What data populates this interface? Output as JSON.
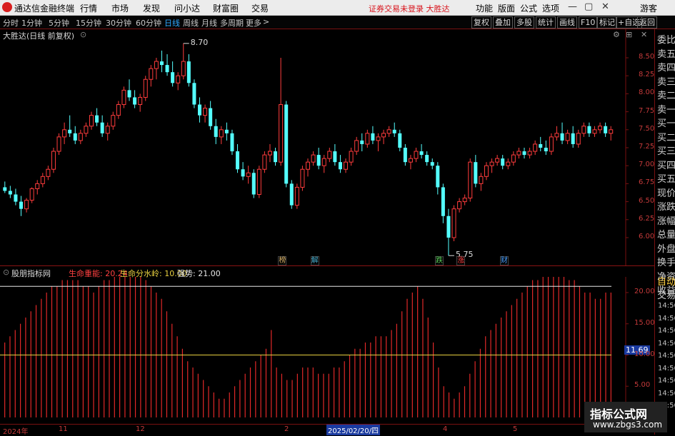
{
  "menubar": {
    "app_title": "通达信金融终端",
    "menus": [
      "行情",
      "市场",
      "发现",
      "问小达",
      "财富圈",
      "交易"
    ],
    "notice": "证券交易未登录  大胜达",
    "right_menus": [
      "功能",
      "版面",
      "公式",
      "选项"
    ],
    "user": "游客"
  },
  "periodbar": {
    "periods": [
      "分时",
      "1分钟",
      "5分钟",
      "15分钟",
      "30分钟",
      "60分钟",
      "日线",
      "周线",
      "月线",
      "多周期",
      "更多"
    ],
    "active_period": "日线",
    "tools": [
      "复权",
      "叠加",
      "多股",
      "统计",
      "画线",
      "F10",
      "标记",
      "+自选",
      "返回"
    ]
  },
  "main_chart": {
    "title": "大胜达(日线 前复权)",
    "y_ticks": [
      "8.50",
      "8.25",
      "8.00",
      "7.75",
      "7.50",
      "7.25",
      "7.00",
      "6.75",
      "6.50",
      "6.25",
      "6.00"
    ],
    "high_label": "8.70",
    "low_label": "5.75",
    "markers": [
      {
        "text": "榜",
        "color": "#d9b36a"
      },
      {
        "text": "解",
        "color": "#4ab0d0"
      },
      {
        "text": "跌",
        "color": "#5ad05a"
      },
      {
        "text": "涨",
        "color": "#ff4040"
      },
      {
        "text": "财",
        "color": "#4aa0ff"
      }
    ]
  },
  "indicator": {
    "name": "股朋指标网",
    "items": [
      {
        "label": "生命重能: 20.24",
        "color": "#ff4040"
      },
      {
        "label": "生命分水岭: 10.00",
        "color": "#e8d040"
      },
      {
        "label": "强势: 21.00",
        "color": "#e8e8e8"
      }
    ],
    "y_ticks": [
      "20.00",
      "15.00",
      "10.00",
      "5.00"
    ],
    "current_value": "11.69"
  },
  "x_axis": {
    "labels": [
      "2024年",
      "11",
      "12",
      "2",
      "2025/02/20/四",
      "4",
      "5"
    ]
  },
  "right_panel": {
    "labels": [
      "委比",
      "卖五",
      "卖四",
      "卖三",
      "卖二",
      "卖一",
      "买一",
      "买二",
      "买三",
      "买四",
      "买五",
      "现价",
      "涨跌",
      "涨幅",
      "总量",
      "外盘",
      "换手",
      "净资",
      "收益",
      "自动",
      "交易"
    ],
    "times": [
      "14:56",
      "14:56",
      "14:56",
      "14:56",
      "14:56",
      "14:56",
      "14:56",
      "14:56",
      "14:56"
    ]
  },
  "watermark": {
    "title": "指标公式网",
    "url": "www.zbgs3.com"
  },
  "chart_data": [
    {
      "type": "candlestick",
      "title": "大胜达(日线 前复权)",
      "ylim": [
        5.75,
        8.75
      ],
      "ohlc": [
        [
          6.7,
          6.78,
          6.62,
          6.65
        ],
        [
          6.65,
          6.72,
          6.55,
          6.6
        ],
        [
          6.6,
          6.68,
          6.45,
          6.5
        ],
        [
          6.5,
          6.58,
          6.3,
          6.4
        ],
        [
          6.4,
          6.55,
          6.35,
          6.52
        ],
        [
          6.52,
          6.7,
          6.48,
          6.68
        ],
        [
          6.68,
          6.8,
          6.6,
          6.75
        ],
        [
          6.75,
          6.9,
          6.7,
          6.85
        ],
        [
          6.85,
          7.0,
          6.8,
          6.95
        ],
        [
          6.95,
          7.25,
          6.9,
          7.2
        ],
        [
          7.2,
          7.45,
          7.15,
          7.4
        ],
        [
          7.4,
          7.6,
          7.3,
          7.5
        ],
        [
          7.5,
          7.7,
          7.4,
          7.45
        ],
        [
          7.45,
          7.55,
          7.3,
          7.35
        ],
        [
          7.35,
          7.5,
          7.3,
          7.45
        ],
        [
          7.45,
          7.6,
          7.4,
          7.55
        ],
        [
          7.55,
          7.75,
          7.5,
          7.7
        ],
        [
          7.7,
          7.8,
          7.55,
          7.6
        ],
        [
          7.6,
          7.7,
          7.4,
          7.45
        ],
        [
          7.45,
          7.6,
          7.35,
          7.55
        ],
        [
          7.55,
          7.75,
          7.5,
          7.7
        ],
        [
          7.7,
          7.9,
          7.65,
          7.85
        ],
        [
          7.85,
          8.1,
          7.8,
          8.05
        ],
        [
          8.05,
          8.2,
          7.9,
          7.95
        ],
        [
          7.95,
          8.05,
          7.8,
          7.85
        ],
        [
          7.85,
          8.0,
          7.75,
          7.95
        ],
        [
          7.95,
          8.25,
          7.9,
          8.2
        ],
        [
          8.2,
          8.4,
          8.1,
          8.35
        ],
        [
          8.35,
          8.5,
          8.2,
          8.45
        ],
        [
          8.45,
          8.6,
          8.3,
          8.4
        ],
        [
          8.4,
          8.55,
          8.25,
          8.3
        ],
        [
          8.3,
          8.45,
          8.1,
          8.15
        ],
        [
          8.15,
          8.3,
          8.05,
          8.25
        ],
        [
          8.25,
          8.7,
          8.2,
          8.45
        ],
        [
          8.45,
          8.55,
          8.1,
          8.15
        ],
        [
          8.15,
          8.2,
          7.8,
          7.85
        ],
        [
          7.85,
          7.95,
          7.6,
          7.7
        ],
        [
          7.7,
          7.85,
          7.6,
          7.8
        ],
        [
          7.8,
          7.9,
          7.5,
          7.55
        ],
        [
          7.55,
          7.65,
          7.3,
          7.4
        ],
        [
          7.4,
          7.55,
          7.3,
          7.5
        ],
        [
          7.5,
          7.6,
          7.35,
          7.45
        ],
        [
          7.45,
          7.5,
          7.15,
          7.2
        ],
        [
          7.2,
          7.3,
          6.9,
          6.95
        ],
        [
          6.95,
          7.05,
          6.8,
          6.85
        ],
        [
          6.85,
          7.0,
          6.75,
          6.9
        ],
        [
          6.9,
          6.95,
          6.55,
          6.6
        ],
        [
          6.6,
          7.0,
          6.55,
          6.95
        ],
        [
          6.95,
          7.2,
          6.9,
          7.15
        ],
        [
          7.15,
          7.3,
          7.05,
          7.2
        ],
        [
          7.2,
          7.25,
          7.0,
          7.05
        ],
        [
          7.05,
          8.5,
          7.0,
          7.85
        ],
        [
          7.85,
          7.9,
          6.7,
          6.75
        ],
        [
          6.75,
          6.8,
          6.4,
          6.45
        ],
        [
          6.45,
          6.75,
          6.4,
          6.7
        ],
        [
          6.7,
          7.0,
          6.65,
          6.95
        ],
        [
          6.95,
          7.1,
          6.85,
          7.05
        ],
        [
          7.05,
          7.2,
          7.0,
          7.15
        ],
        [
          7.15,
          7.25,
          6.95,
          7.0
        ],
        [
          7.0,
          7.15,
          6.9,
          7.1
        ],
        [
          7.1,
          7.25,
          7.05,
          7.2
        ],
        [
          7.2,
          7.3,
          7.0,
          7.05
        ],
        [
          7.05,
          7.15,
          6.9,
          6.95
        ],
        [
          6.95,
          7.1,
          6.9,
          7.05
        ],
        [
          7.05,
          7.25,
          7.0,
          7.2
        ],
        [
          7.2,
          7.4,
          7.15,
          7.35
        ],
        [
          7.35,
          7.45,
          7.2,
          7.3
        ],
        [
          7.3,
          7.5,
          7.25,
          7.45
        ],
        [
          7.45,
          7.55,
          7.3,
          7.35
        ],
        [
          7.35,
          7.45,
          7.2,
          7.4
        ],
        [
          7.4,
          7.5,
          7.3,
          7.45
        ],
        [
          7.45,
          7.55,
          7.4,
          7.5
        ],
        [
          7.5,
          7.6,
          7.4,
          7.45
        ],
        [
          7.45,
          7.5,
          7.2,
          7.25
        ],
        [
          7.25,
          7.3,
          7.0,
          7.05
        ],
        [
          7.05,
          7.15,
          6.95,
          7.1
        ],
        [
          7.1,
          7.25,
          7.05,
          7.2
        ],
        [
          7.2,
          7.3,
          7.1,
          7.15
        ],
        [
          7.15,
          7.2,
          7.0,
          7.05
        ],
        [
          7.05,
          7.1,
          6.95,
          7.0
        ],
        [
          7.0,
          7.05,
          6.6,
          6.7
        ],
        [
          6.7,
          6.75,
          6.2,
          6.3
        ],
        [
          6.3,
          6.4,
          5.75,
          6.0
        ],
        [
          6.0,
          6.45,
          5.95,
          6.4
        ],
        [
          6.4,
          6.55,
          6.35,
          6.5
        ],
        [
          6.5,
          6.6,
          6.45,
          6.55
        ],
        [
          6.55,
          7.1,
          6.5,
          7.05
        ],
        [
          7.05,
          7.15,
          6.7,
          6.75
        ],
        [
          6.75,
          6.9,
          6.65,
          6.85
        ],
        [
          6.85,
          7.05,
          6.8,
          7.0
        ],
        [
          7.0,
          7.1,
          6.9,
          7.05
        ],
        [
          7.05,
          7.15,
          7.0,
          7.1
        ],
        [
          7.1,
          7.15,
          6.95,
          7.0
        ],
        [
          7.0,
          7.1,
          6.95,
          7.05
        ],
        [
          7.05,
          7.2,
          7.0,
          7.15
        ],
        [
          7.15,
          7.25,
          7.1,
          7.2
        ],
        [
          7.2,
          7.25,
          7.1,
          7.15
        ],
        [
          7.15,
          7.25,
          7.1,
          7.2
        ],
        [
          7.2,
          7.35,
          7.15,
          7.3
        ],
        [
          7.3,
          7.4,
          7.2,
          7.25
        ],
        [
          7.25,
          7.35,
          7.15,
          7.2
        ],
        [
          7.2,
          7.45,
          7.15,
          7.4
        ],
        [
          7.4,
          7.55,
          7.35,
          7.45
        ],
        [
          7.45,
          7.6,
          7.3,
          7.35
        ],
        [
          7.35,
          7.5,
          7.3,
          7.45
        ],
        [
          7.45,
          7.55,
          7.25,
          7.3
        ],
        [
          7.3,
          7.5,
          7.25,
          7.45
        ],
        [
          7.45,
          7.6,
          7.4,
          7.55
        ],
        [
          7.55,
          7.6,
          7.4,
          7.45
        ],
        [
          7.45,
          7.55,
          7.4,
          7.5
        ],
        [
          7.5,
          7.6,
          7.45,
          7.55
        ],
        [
          7.55,
          7.6,
          7.4,
          7.45
        ],
        [
          7.45,
          7.55,
          7.35,
          7.5
        ]
      ]
    },
    {
      "type": "bar",
      "title": "股朋指标网",
      "ylim": [
        0,
        25
      ],
      "reference_lines": [
        {
          "name": "生命分水岭",
          "value": 10.0
        },
        {
          "name": "强势",
          "value": 21.0
        }
      ],
      "values": [
        12,
        13,
        14,
        15,
        16,
        17,
        18,
        19,
        20,
        21,
        21,
        22,
        22,
        22,
        22,
        21,
        21,
        20,
        21,
        22,
        22,
        23,
        23,
        23,
        24,
        24,
        23,
        22,
        21,
        20,
        19,
        17,
        15,
        13,
        11,
        9,
        8,
        7,
        6,
        5,
        4,
        3,
        3,
        4,
        5,
        6,
        7,
        8,
        9,
        10,
        11,
        14,
        8,
        7,
        6,
        6,
        7,
        8,
        8,
        8,
        7,
        7,
        7,
        8,
        8,
        9,
        10,
        11,
        11,
        12,
        12,
        13,
        13,
        13,
        14,
        15,
        17,
        19,
        20,
        21,
        19,
        16,
        12,
        8,
        5,
        4,
        3,
        4,
        5,
        7,
        9,
        11,
        13,
        14,
        15,
        16,
        17,
        18,
        19,
        20,
        21,
        22,
        22,
        23,
        23,
        24,
        24,
        23,
        22,
        22,
        21,
        20,
        20,
        19,
        19,
        20,
        20
      ]
    }
  ]
}
